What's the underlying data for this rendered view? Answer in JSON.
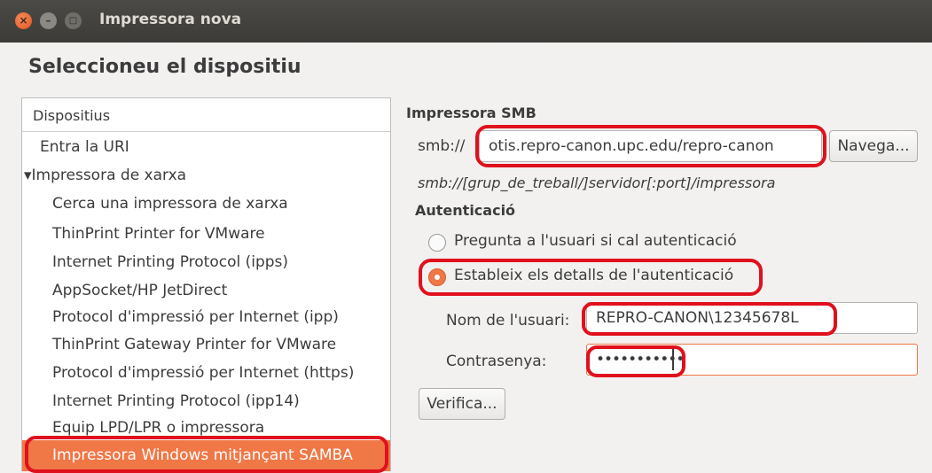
{
  "window": {
    "title": "Impressora nova"
  },
  "page": {
    "heading": "Seleccioneu el dispositiu"
  },
  "devices": {
    "header": "Dispositius",
    "items": [
      {
        "label": "Entra la URI"
      },
      {
        "label": "▾Impressora de xarxa"
      },
      {
        "label": "Cerca una impressora de xarxa"
      },
      {
        "label": "ThinPrint Printer for VMware"
      },
      {
        "label": "Internet Printing Protocol (ipps)"
      },
      {
        "label": "AppSocket/HP JetDirect"
      },
      {
        "label": "Protocol d'impressió per Internet (ipp)"
      },
      {
        "label": "ThinPrint Gateway Printer for VMware"
      },
      {
        "label": "Protocol d'impressió per Internet (https)"
      },
      {
        "label": "Internet Printing Protocol (ipp14)"
      },
      {
        "label": "Equip LPD/LPR o impressora"
      },
      {
        "label": "Impressora Windows mitjançant SAMBA"
      }
    ]
  },
  "smb": {
    "section_title": "Impressora SMB",
    "prefix": "smb://",
    "uri_value": "otis.repro-canon.upc.edu/repro-canon",
    "browse_label": "Navega...",
    "hint": "smb://[grup_de_treball/]servidor[:port]/impressora"
  },
  "auth": {
    "section_title": "Autenticació",
    "option_ask": "Pregunta a l'usuari si cal autenticació",
    "option_set": "Estableix els detalls de l'autenticació",
    "username_label": "Nom de l'usuari:",
    "username_value": "REPRO-CANON\\12345678L",
    "password_label": "Contrasenya:",
    "password_value": "•••••••••••",
    "verify_label": "Verifica..."
  }
}
